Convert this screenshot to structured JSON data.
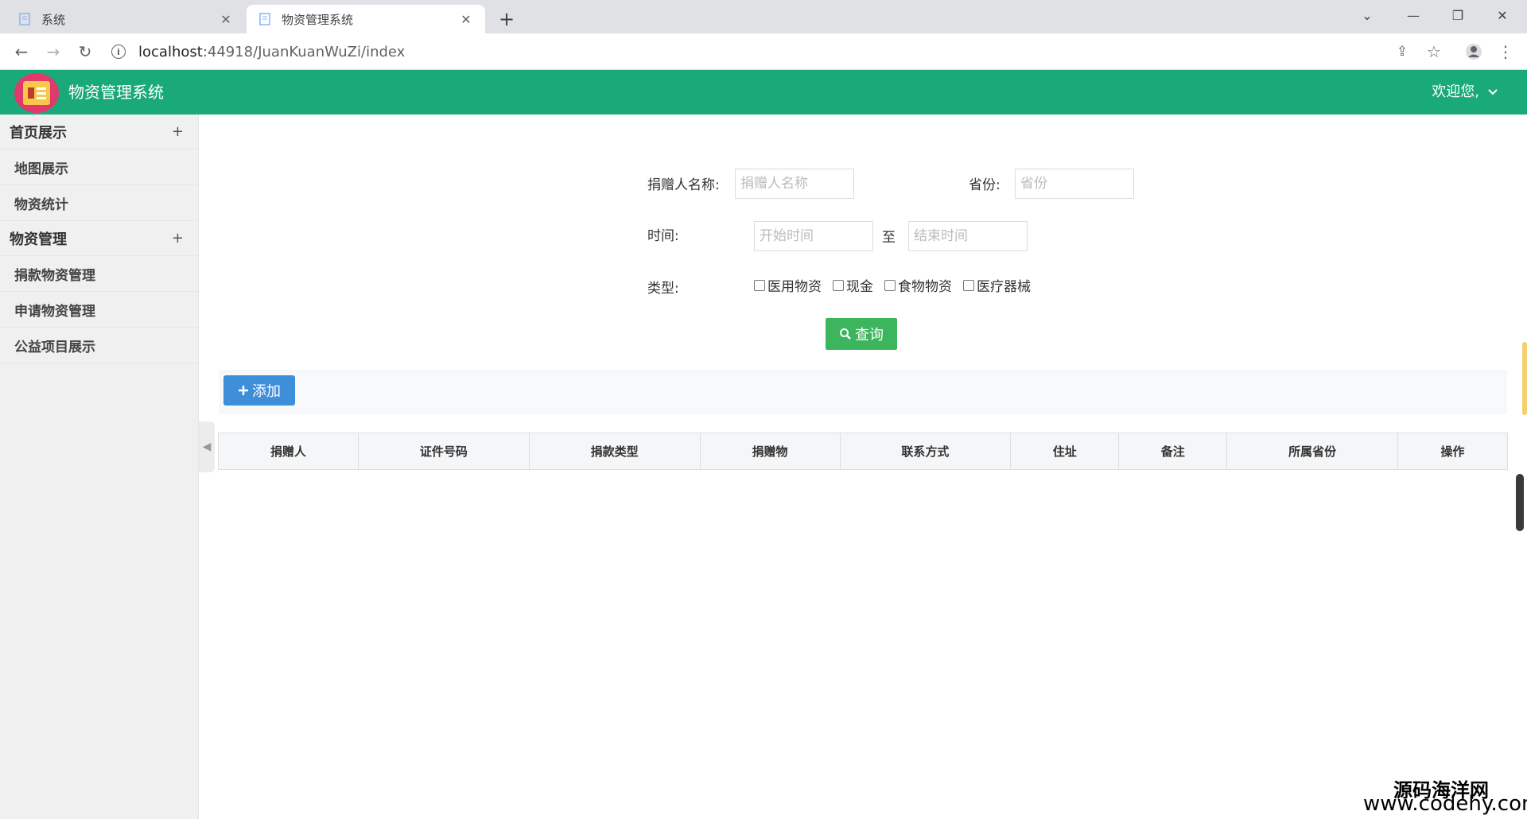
{
  "browser": {
    "tabs": [
      {
        "title": "系统",
        "active": false
      },
      {
        "title": "物资管理系统",
        "active": true
      }
    ],
    "url_host": "localhost",
    "url_path": ":44918/JuanKuanWuZi/index",
    "new_tab": "+"
  },
  "app": {
    "title": "物资管理系统",
    "welcome": "欢迎您,"
  },
  "sidebar": {
    "groups": [
      {
        "label": "首页展示",
        "toggle": "+",
        "items": [
          "地图展示",
          "物资统计"
        ]
      },
      {
        "label": "物资管理",
        "toggle": "+",
        "items": [
          "捐款物资管理",
          "申请物资管理",
          "公益项目展示"
        ]
      }
    ]
  },
  "search": {
    "donor_label": "捐赠人名称:",
    "donor_placeholder": "捐赠人名称",
    "province_label": "省份:",
    "province_placeholder": "省份",
    "time_label": "时间:",
    "start_placeholder": "开始时间",
    "to_label": "至",
    "end_placeholder": "结束时间",
    "type_label": "类型:",
    "types": [
      "医用物资",
      "现金",
      "食物物资",
      "医疗器械"
    ],
    "query_button": "查询"
  },
  "actions": {
    "add_button": "添加"
  },
  "table": {
    "headers": [
      "捐赠人",
      "证件号码",
      "捐款类型",
      "捐赠物",
      "联系方式",
      "住址",
      "备注",
      "所属省份",
      "操作"
    ]
  },
  "watermark": {
    "line1": "源码海洋网",
    "line2": "www.codehy.com"
  },
  "colors": {
    "header_green": "#1aa979",
    "search_green": "#3cb55d",
    "add_blue": "#3e8ed9"
  }
}
